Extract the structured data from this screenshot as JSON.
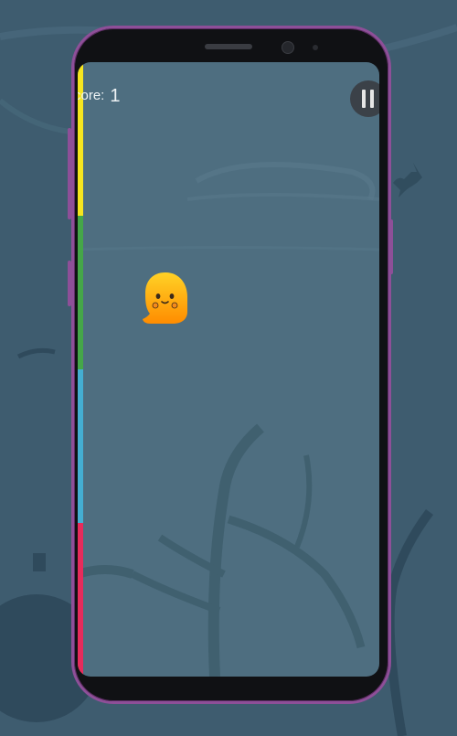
{
  "game": {
    "score_label": "core:",
    "score_value": "1",
    "pause_icon": "pause-icon",
    "player_icon": "ghost-icon",
    "decor_icons": [
      "bat-icon",
      "tree-silhouette",
      "pumpkin-silhouette"
    ]
  },
  "color_strip": {
    "colors": [
      "#f6e51f",
      "#45a648",
      "#44aed2",
      "#e72b5b"
    ],
    "fractions": [
      0.25,
      0.25,
      0.25,
      0.25
    ]
  },
  "colors": {
    "background": "#3e5c6f",
    "screen": "#4e6e80",
    "phone_frame": "#8e4f98",
    "ghost_top": "#ffd226",
    "ghost_bottom": "#ff8c00"
  }
}
